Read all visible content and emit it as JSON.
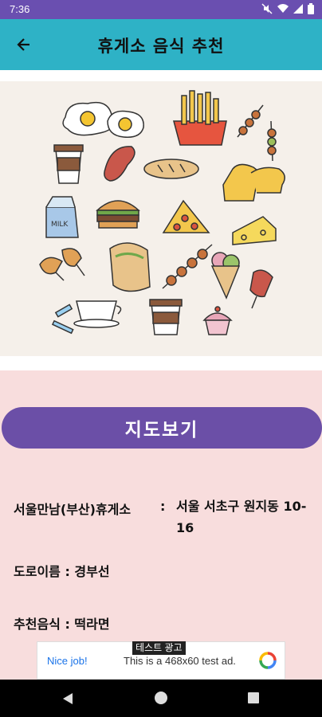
{
  "status_bar": {
    "time": "7:36"
  },
  "app_bar": {
    "title": "휴게소 음식 추천"
  },
  "hero": {
    "milk_label": "MILK"
  },
  "map_button": {
    "label": "지도보기"
  },
  "info": {
    "rest_area": "서울만남(부산)휴게소",
    "colon": ":",
    "address": "서울 서초구 원지동 10-16",
    "road_label": "도로이름 : 경부선",
    "food_label": "추천음식  :  떡라면"
  },
  "ad": {
    "tag": "테스트 광고",
    "nice": "Nice job!",
    "text": "This is a 468x60 test ad."
  },
  "colors": {
    "status": "#6a4fb0",
    "app_bar": "#2eb2c6",
    "button": "#6b4fa7",
    "background": "#f8dddd"
  }
}
